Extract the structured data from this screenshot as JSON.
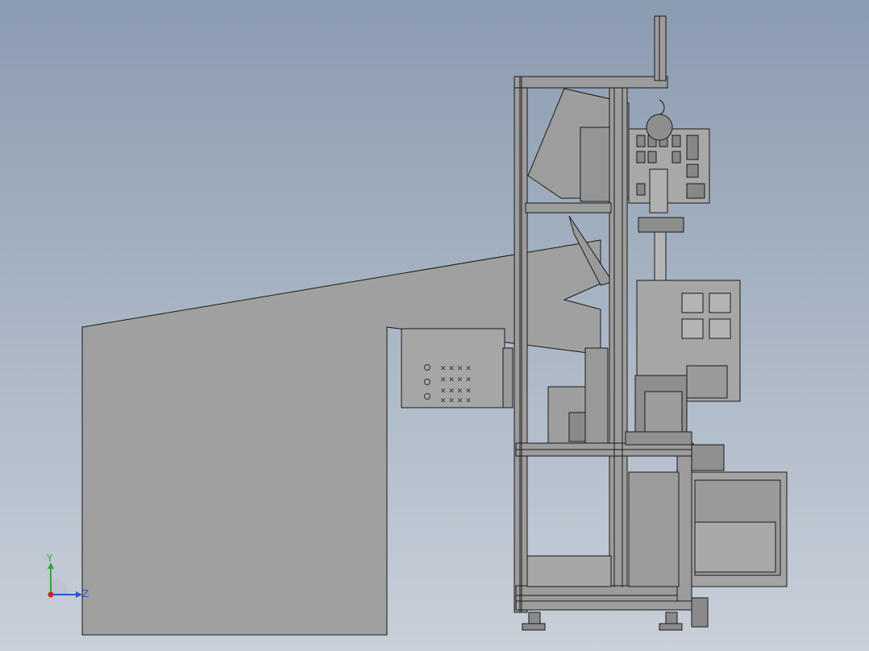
{
  "viewport": {
    "background_top": "#8b9bb0",
    "background_bottom": "#c8d0d9",
    "model_fill": "#a0a0a0",
    "model_dark": "#8c8c8c",
    "frame_color": "#9a9a9a",
    "edge_color": "#1a1a1a"
  },
  "triad": {
    "y_label": "Y",
    "z_label": "Z",
    "y_color": "#2fa83a",
    "z_color": "#2b55d6",
    "x_color": "#d02020"
  }
}
